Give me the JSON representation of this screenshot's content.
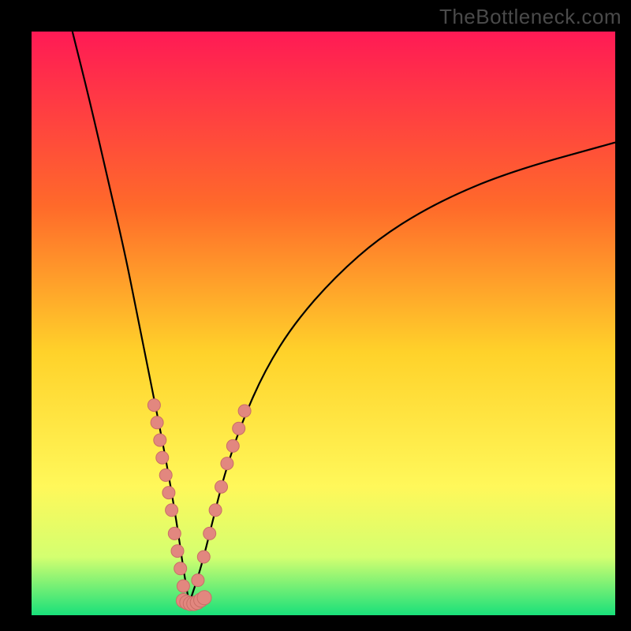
{
  "watermark": "TheBottleneck.com",
  "chart_data": {
    "type": "line",
    "title": "",
    "xlabel": "",
    "ylabel": "",
    "xlim": [
      0,
      100
    ],
    "ylim": [
      0,
      100
    ],
    "optimal_x": 27,
    "background_gradient": {
      "top": "#ff1a55",
      "upper_mid": "#ff6a2a",
      "mid": "#ffd22a",
      "lower_mid": "#fff85a",
      "lower": "#d4ff70",
      "bottom": "#19e07a"
    },
    "curve_left": {
      "description": "Steep descending branch from top-left toward minimum",
      "points_xy": [
        [
          7,
          100
        ],
        [
          10,
          88
        ],
        [
          13,
          75
        ],
        [
          16,
          62
        ],
        [
          18,
          52
        ],
        [
          20,
          42
        ],
        [
          22,
          32
        ],
        [
          23.5,
          24
        ],
        [
          25,
          15
        ],
        [
          26,
          8
        ],
        [
          27,
          2
        ]
      ]
    },
    "curve_right": {
      "description": "Ascending branch from minimum, concave, flattening toward right",
      "points_xy": [
        [
          27,
          2
        ],
        [
          29,
          8
        ],
        [
          31,
          16
        ],
        [
          33,
          24
        ],
        [
          36,
          33
        ],
        [
          40,
          42
        ],
        [
          45,
          50
        ],
        [
          52,
          58
        ],
        [
          60,
          65
        ],
        [
          70,
          71
        ],
        [
          82,
          76
        ],
        [
          100,
          81
        ]
      ]
    },
    "markers_left_branch": {
      "note": "Clustered markers along lower portion of left branch (approx y between 5 and 35)",
      "xy": [
        [
          21.0,
          36
        ],
        [
          21.5,
          33
        ],
        [
          22.0,
          30
        ],
        [
          22.4,
          27
        ],
        [
          23.0,
          24
        ],
        [
          23.5,
          21
        ],
        [
          24.0,
          18
        ],
        [
          24.5,
          14
        ],
        [
          25.0,
          11
        ],
        [
          25.5,
          8
        ],
        [
          26.0,
          5
        ]
      ]
    },
    "markers_right_branch": {
      "note": "Clustered markers along lower portion of right branch (approx y between 5 and 35)",
      "xy": [
        [
          28.5,
          6
        ],
        [
          29.5,
          10
        ],
        [
          30.5,
          14
        ],
        [
          31.5,
          18
        ],
        [
          32.5,
          22
        ],
        [
          33.5,
          26
        ],
        [
          34.5,
          29
        ],
        [
          35.5,
          32
        ],
        [
          36.5,
          35
        ]
      ]
    },
    "markers_bottom": {
      "note": "Overlapping cluster near the curve minimum",
      "xy": [
        [
          26.0,
          2.5
        ],
        [
          26.6,
          2.2
        ],
        [
          27.2,
          2.0
        ],
        [
          27.8,
          2.0
        ],
        [
          28.4,
          2.2
        ],
        [
          29.0,
          2.6
        ],
        [
          29.6,
          3.0
        ]
      ]
    },
    "marker_color": "#e2877f",
    "marker_stroke": "#c96e66",
    "curve_color": "#000000"
  }
}
